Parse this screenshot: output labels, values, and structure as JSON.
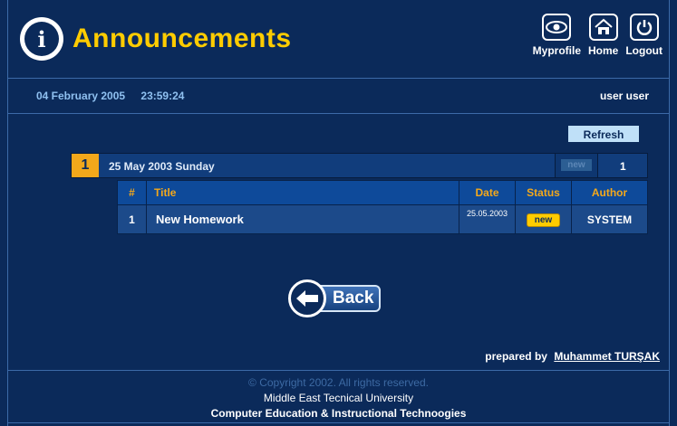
{
  "header": {
    "title": "Announcements",
    "nav": [
      {
        "label": "Myprofile",
        "icon": "eye-icon"
      },
      {
        "label": "Home",
        "icon": "home-icon"
      },
      {
        "label": "Logout",
        "icon": "power-icon"
      }
    ]
  },
  "info": {
    "date": "04 February 2005",
    "time": "23:59:24",
    "user": "user user"
  },
  "toolbar": {
    "refresh_label": "Refresh"
  },
  "day_group": {
    "index": "1",
    "label": "25 May 2003 Sunday",
    "new_label": "new",
    "count": "1"
  },
  "table": {
    "headers": [
      "#",
      "Title",
      "Date",
      "Status",
      "Author"
    ],
    "rows": [
      {
        "num": "1",
        "title": "New Homework",
        "date": "25.05.2003",
        "status": "new",
        "author": "SYSTEM"
      }
    ]
  },
  "back_label": "Back",
  "prepared": {
    "prefix": "prepared by",
    "author": "Muhammet TURŞAK"
  },
  "footer": {
    "copyright": "© Copyright 2002. All rights reserved.",
    "university": "Middle East Tecnical University",
    "department": "Computer Education & Instructional Technoogies"
  },
  "colors": {
    "background": "#0b2a5a",
    "accent": "#ffcc00",
    "highlight": "#f3a81b"
  }
}
